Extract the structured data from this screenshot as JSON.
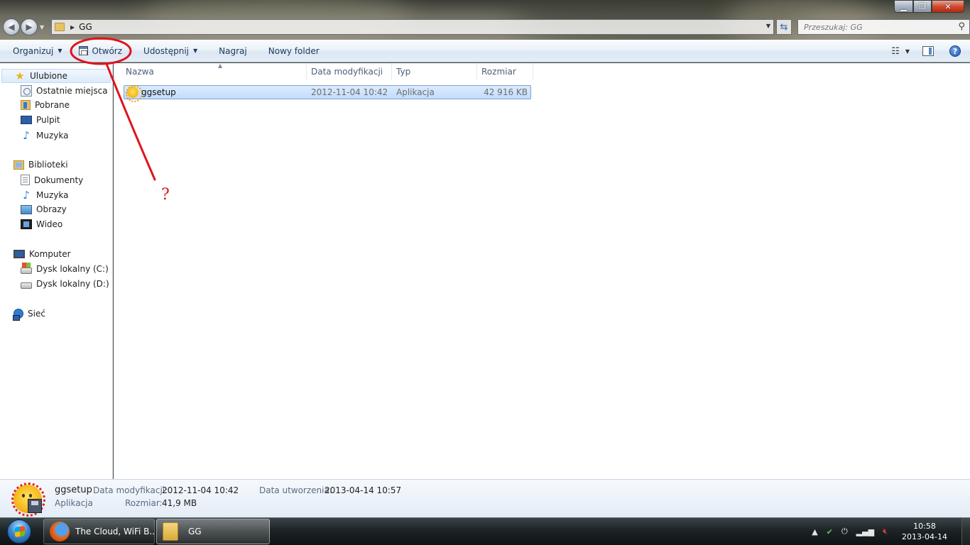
{
  "window": {
    "controls": {
      "minimize_glyph": "▁",
      "maximize_glyph": "❐",
      "close_glyph": "✕"
    }
  },
  "address_bar": {
    "path": "GG",
    "back_glyph": "◀",
    "forward_glyph": "▶",
    "refresh_glyph": "⇆"
  },
  "search": {
    "placeholder": "Przeszukaj: GG",
    "icon": "magnifier-icon"
  },
  "toolbar": {
    "organize": "Organizuj",
    "open": "Otwórz",
    "share": "Udostępnij",
    "burn": "Nagraj",
    "new_folder": "Nowy folder",
    "help": "?"
  },
  "annotation": {
    "text": "?",
    "color": "#e0141c"
  },
  "navigation": {
    "favorites": {
      "label": "Ulubione",
      "items": [
        "Ostatnie miejsca",
        "Pobrane",
        "Pulpit",
        "Muzyka"
      ]
    },
    "libraries": {
      "label": "Biblioteki",
      "items": [
        "Dokumenty",
        "Muzyka",
        "Obrazy",
        "Wideo"
      ]
    },
    "computer": {
      "label": "Komputer",
      "items": [
        "Dysk lokalny (C:)",
        "Dysk lokalny (D:)"
      ]
    },
    "network": {
      "label": "Sieć"
    }
  },
  "file_list": {
    "columns": [
      "Nazwa",
      "Data modyfikacji",
      "Typ",
      "Rozmiar"
    ],
    "rows": [
      {
        "name": "ggsetup",
        "modified": "2012-11-04 10:42",
        "type": "Aplikacja",
        "size": "42 916 KB",
        "selected": true
      }
    ]
  },
  "details": {
    "name": "ggsetup",
    "type": "Aplikacja",
    "modified_label": "Data modyfikacji:",
    "modified_value": "2012-11-04 10:42",
    "size_label": "Rozmiar:",
    "size_value": "41,9 MB",
    "created_label": "Data utworzenia:",
    "created_value": "2013-04-14 10:57"
  },
  "taskbar": {
    "buttons": [
      {
        "label": "The Cloud, WiFi B...",
        "icon": "firefox-icon"
      },
      {
        "label": "GG",
        "icon": "folder-icon"
      }
    ],
    "tray": {
      "arrow": "▲",
      "time": "10:58",
      "date": "2013-04-14"
    }
  },
  "colors": {
    "selection": "#c2dcfd",
    "command_bar": "#e4edf7",
    "taskbar": "#1d2426",
    "annotation_red": "#e0141c"
  }
}
